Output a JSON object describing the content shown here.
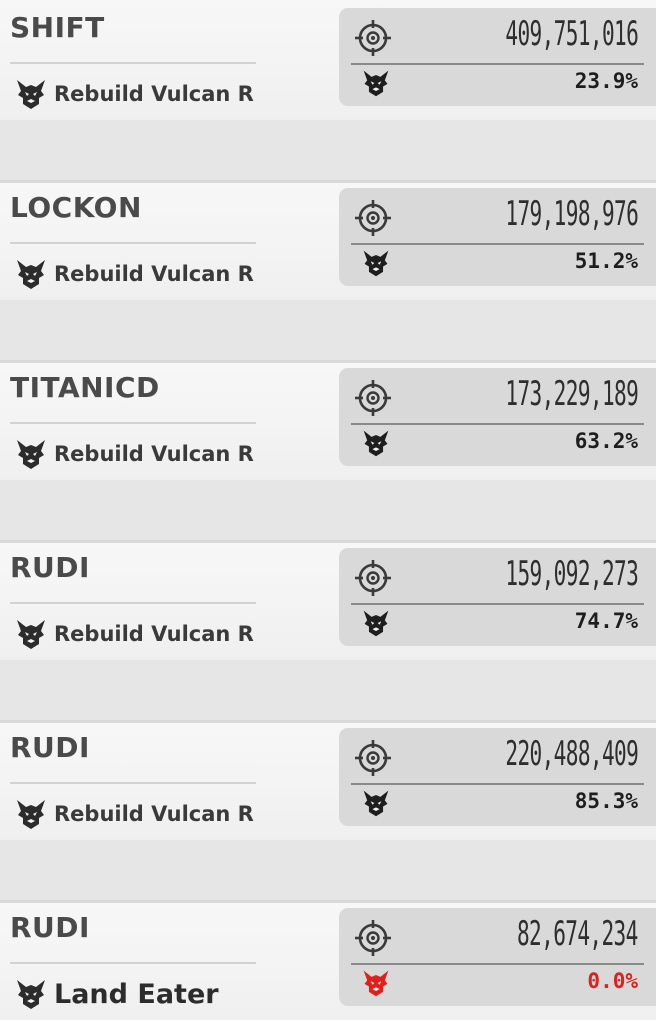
{
  "accent": {
    "text_dark": "#2e2e2e",
    "panel": "#d9d9d9",
    "zero_red": "#e0201c"
  },
  "entries": [
    {
      "player": "SHIFT",
      "boss": "Rebuild Vulcan R",
      "boss_icon": "boss-emblem-icon",
      "damage": "409,751,016",
      "percent": "23.9%",
      "percent_value": 23.9
    },
    {
      "player": "LOCKON",
      "boss": "Rebuild Vulcan R",
      "boss_icon": "boss-emblem-icon",
      "damage": "179,198,976",
      "percent": "51.2%",
      "percent_value": 51.2
    },
    {
      "player": "TITANICD",
      "boss": "Rebuild Vulcan R",
      "boss_icon": "boss-emblem-icon",
      "damage": "173,229,189",
      "percent": "63.2%",
      "percent_value": 63.2
    },
    {
      "player": "RUDI",
      "boss": "Rebuild Vulcan R",
      "boss_icon": "boss-emblem-icon",
      "damage": "159,092,273",
      "percent": "74.7%",
      "percent_value": 74.7
    },
    {
      "player": "RUDI",
      "boss": "Rebuild Vulcan R",
      "boss_icon": "boss-emblem-icon",
      "damage": "220,488,409",
      "percent": "85.3%",
      "percent_value": 85.3
    },
    {
      "player": "RUDI",
      "boss": "Land Eater",
      "boss_icon": "boss-emblem-icon",
      "damage": "82,674,234",
      "percent": "0.0%",
      "percent_value": 0.0
    }
  ]
}
